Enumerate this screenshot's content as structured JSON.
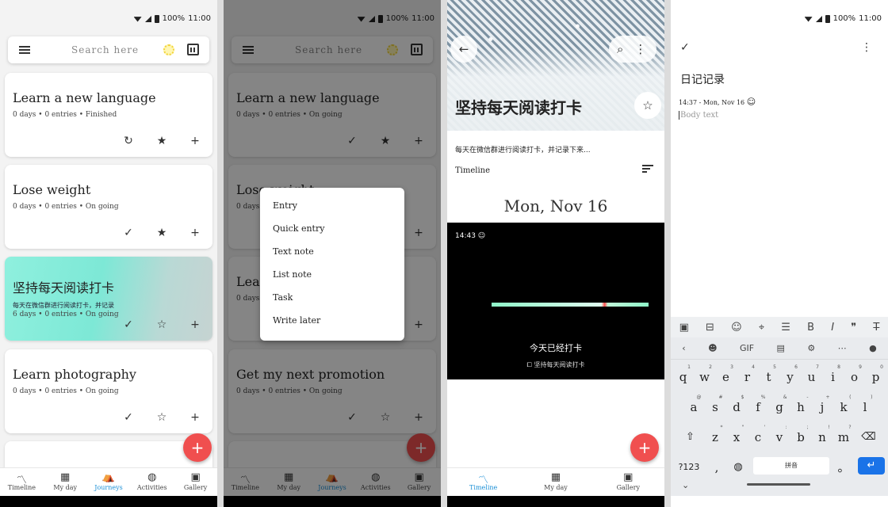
{
  "status": {
    "battery": "100%",
    "time": "11:00"
  },
  "search": {
    "placeholder": "Search here"
  },
  "journeys": [
    {
      "title": "Learn a new language",
      "meta": "0 days • 0 entries • Finished"
    },
    {
      "title": "Lose weight",
      "meta": "0 days • 0 entries • On going"
    },
    {
      "title": "坚持每天阅读打卡",
      "desc": "每天在微信群进行阅读打卡，并记录",
      "meta": "6 days • 0 entries • On going"
    },
    {
      "title": "Learn photography",
      "meta": "0 days • 0 entries • On going"
    },
    {
      "title": "Get my next promotion",
      "meta": "0 days • 0 entries • On going"
    }
  ],
  "fab": {
    "symbol": "+"
  },
  "nav": {
    "items": [
      {
        "label": "Timeline",
        "icon": "trend-icon"
      },
      {
        "label": "My day",
        "icon": "calendar-icon"
      },
      {
        "label": "Journeys",
        "icon": "backpack-icon"
      },
      {
        "label": "Activities",
        "icon": "globe-icon"
      },
      {
        "label": "Gallery",
        "icon": "image-icon"
      }
    ],
    "active": "Journeys",
    "accent": "#1a8fd6"
  },
  "popup_menu": {
    "items": [
      "Entry",
      "Quick entry",
      "Text note",
      "List note",
      "Task",
      "Write later"
    ]
  },
  "journey_detail": {
    "title": "坚持每天阅读打卡",
    "desc": "每天在微信群进行阅读打卡，并记录下来...",
    "timeline_label": "Timeline",
    "date": "Mon, Nov 16",
    "entry": {
      "time": "14:43",
      "title": "今天已经打卡",
      "tag": "坚持每天阅读打卡"
    },
    "nav": [
      {
        "label": "Timeline"
      },
      {
        "label": "My day"
      },
      {
        "label": "Gallery"
      }
    ]
  },
  "editor": {
    "title": "日记记录",
    "meta": "14:37 - Mon, Nov 16",
    "body_placeholder": "Body text",
    "format_icons": [
      "image-icon",
      "embed-icon",
      "emoji-icon",
      "location-icon",
      "list-icon",
      "bold-icon",
      "italic-icon",
      "quote-icon",
      "strikethrough-icon"
    ],
    "keyboard": {
      "top": {
        "gif": "GIF"
      },
      "row1": [
        {
          "k": "q",
          "s": "1"
        },
        {
          "k": "w",
          "s": "2"
        },
        {
          "k": "e",
          "s": "3"
        },
        {
          "k": "r",
          "s": "4"
        },
        {
          "k": "t",
          "s": "5"
        },
        {
          "k": "y",
          "s": "6"
        },
        {
          "k": "u",
          "s": "7"
        },
        {
          "k": "i",
          "s": "8"
        },
        {
          "k": "o",
          "s": "9"
        },
        {
          "k": "p",
          "s": "0"
        }
      ],
      "row2": [
        {
          "k": "a",
          "s": "@"
        },
        {
          "k": "s",
          "s": "#"
        },
        {
          "k": "d",
          "s": "$"
        },
        {
          "k": "f",
          "s": "%"
        },
        {
          "k": "g",
          "s": "&"
        },
        {
          "k": "h",
          "s": "-"
        },
        {
          "k": "j",
          "s": "+"
        },
        {
          "k": "k",
          "s": "("
        },
        {
          "k": "l",
          "s": ")"
        }
      ],
      "row3": [
        {
          "k": "z",
          "s": "*"
        },
        {
          "k": "x",
          "s": "\""
        },
        {
          "k": "c",
          "s": "'"
        },
        {
          "k": "v",
          "s": ":"
        },
        {
          "k": "b",
          "s": ";"
        },
        {
          "k": "n",
          "s": "!"
        },
        {
          "k": "m",
          "s": "?"
        }
      ],
      "symbols_key": "?123",
      "comma_key": ",",
      "space_label": "拼音",
      "period_key": "。"
    }
  }
}
